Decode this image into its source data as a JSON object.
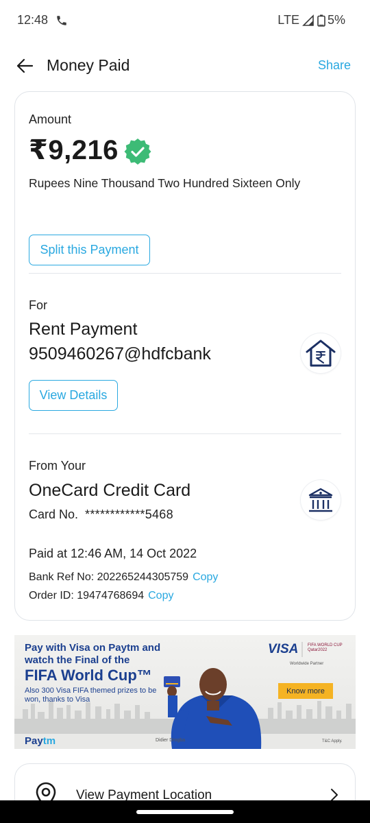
{
  "status_bar": {
    "time": "12:48",
    "network": "LTE",
    "battery": "5%"
  },
  "header": {
    "title": "Money Paid",
    "share_label": "Share"
  },
  "amount_section": {
    "label": "Amount",
    "value": "₹9,216",
    "in_words": "Rupees Nine Thousand Two Hundred Sixteen Only",
    "split_button": "Split this Payment"
  },
  "payee_section": {
    "label": "For",
    "name": "Rent Payment",
    "vpa": "9509460267@hdfcbank",
    "details_button": "View Details"
  },
  "source_section": {
    "label": "From Your",
    "name": "OneCard Credit Card",
    "card_no_label": "Card No.",
    "card_no": "************5468",
    "paid_at": "Paid at 12:46 AM, 14 Oct 2022",
    "bank_ref": "Bank Ref No: 202265244305759",
    "order_id": "Order ID: 19474768694",
    "copy_label": "Copy"
  },
  "ad": {
    "headline": "Pay with Visa on Paytm and watch the Final of the",
    "headline_big": "FIFA World Cup™",
    "subtext": "Also 300 Visa FIFA themed prizes to be won, thanks to Visa",
    "visa_logo": "VISA",
    "fifa_badge": "FIFA WORLD CUP Qatar2022",
    "partner_text": "Worldwide Partner",
    "cta": "Know more",
    "person_name": "Didier Drogba",
    "paytm_logo_a": "Pay",
    "paytm_logo_b": "tm",
    "tc": "T&C Apply."
  },
  "location_card": {
    "label": "View Payment Location"
  },
  "colors": {
    "accent": "#29a8e0",
    "verified": "#3dbb76",
    "icon_navy": "#1b2f63",
    "ad_blue": "#1b3f8f",
    "ad_cta": "#f5b323"
  }
}
